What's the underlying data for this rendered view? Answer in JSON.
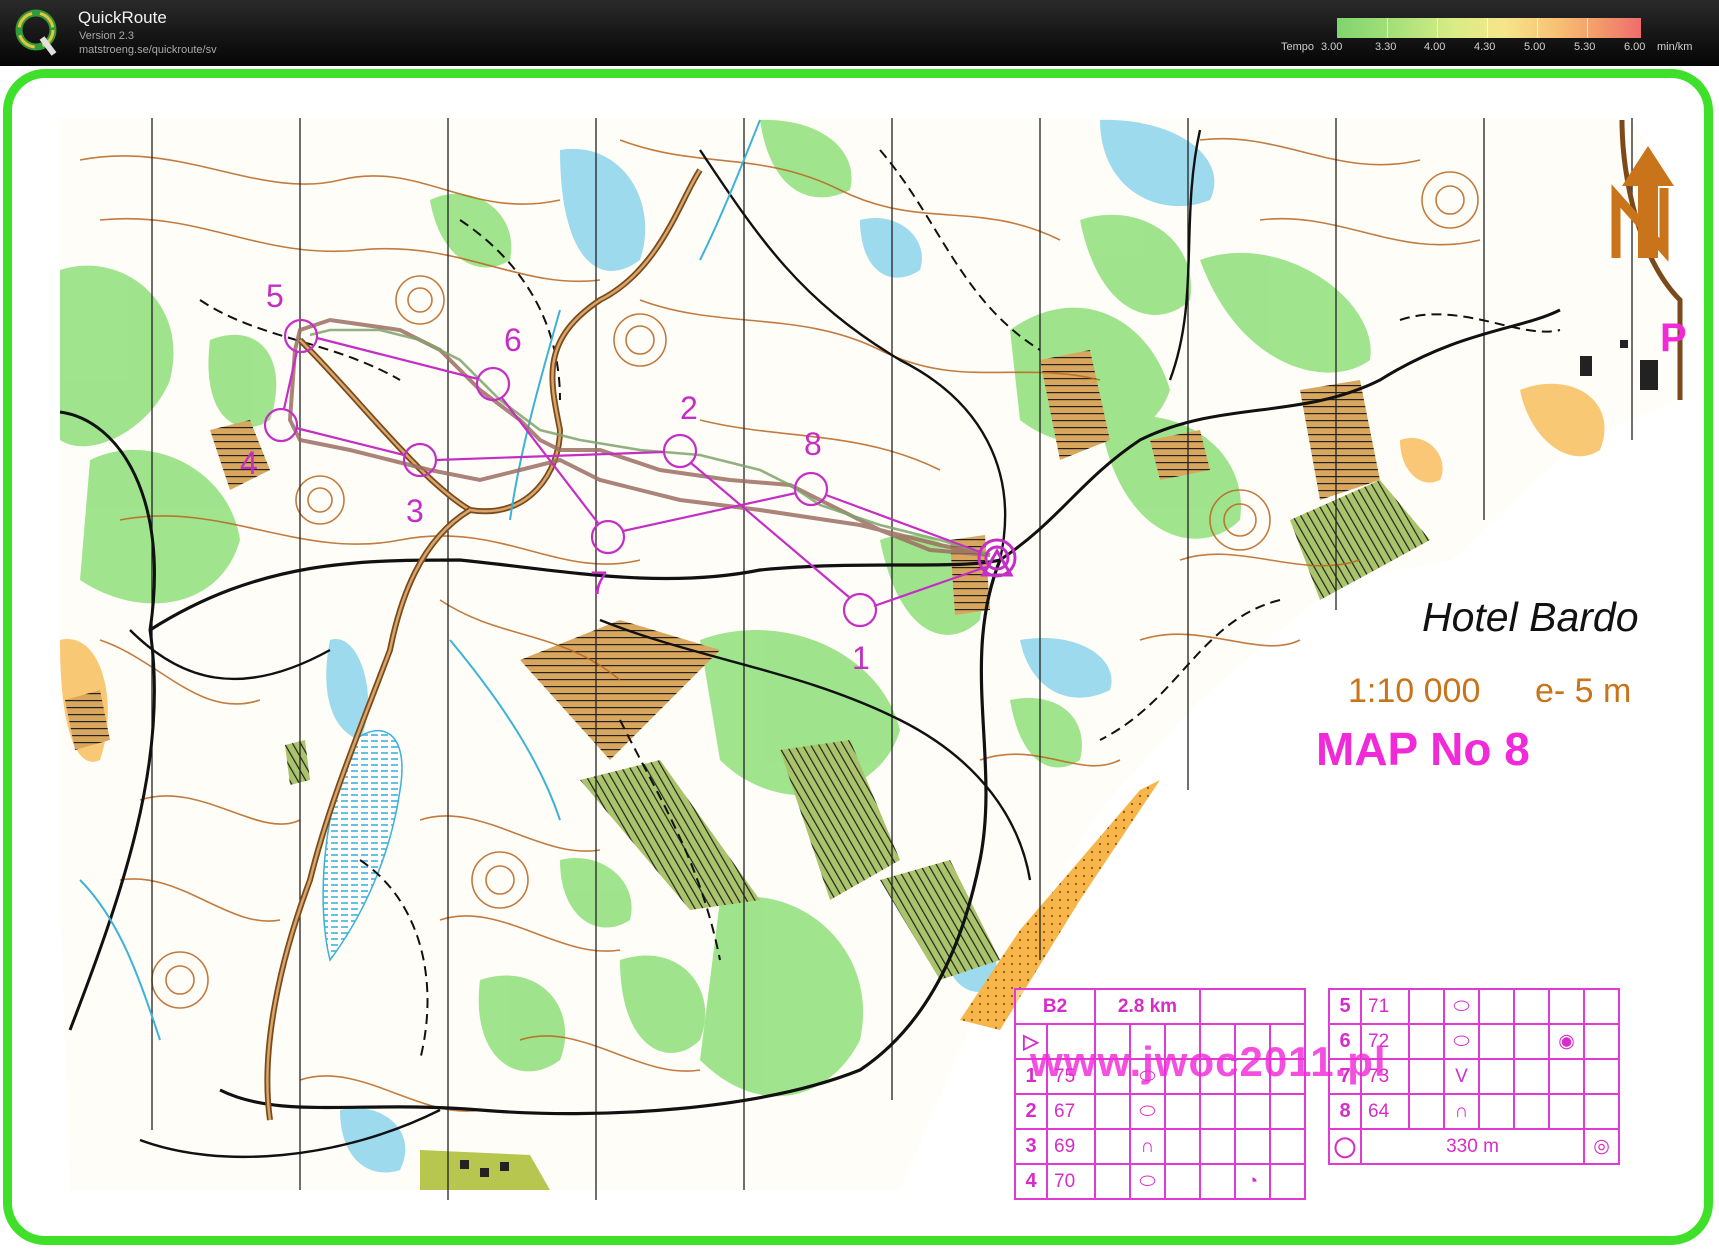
{
  "app": {
    "title": "QuickRoute",
    "version": "Version 2.3",
    "url": "matstroeng.se/quickroute/sv",
    "logo_letter": "Q"
  },
  "tempo_legend": {
    "prefix": "Tempo",
    "ticks": [
      "3.00",
      "3.30",
      "4.00",
      "4.30",
      "5.00",
      "5.30",
      "6.00"
    ],
    "unit": "min/km",
    "colors": [
      "#7fd46d",
      "#d7ec86",
      "#f6e58a",
      "#f7c276",
      "#ef6d6d"
    ]
  },
  "map": {
    "place_name": "Hotel Bardo",
    "scale": "1:10 000",
    "equidistance": "e- 5 m",
    "map_number": "MAP No 8",
    "parking_symbol": "P",
    "watermark": "www.jwoc2011.pl",
    "north_arrow_letter": "N",
    "colors": {
      "border": "#3ee02a",
      "course": "#c52ec5",
      "vegetation": "#8fe07a",
      "contours": "#b8651f",
      "water": "#3cb2d8",
      "route": "#9b6e62"
    }
  },
  "controls": [
    "1",
    "2",
    "3",
    "4",
    "5",
    "6",
    "7",
    "8"
  ],
  "description_sheet": {
    "class": "B2",
    "length": "2.8 km",
    "left_rows": [
      {
        "num": "1",
        "code": "75"
      },
      {
        "num": "2",
        "code": "67"
      },
      {
        "num": "3",
        "code": "69"
      },
      {
        "num": "4",
        "code": "70"
      }
    ],
    "right_rows": [
      {
        "num": "5",
        "code": "71"
      },
      {
        "num": "6",
        "code": "72"
      },
      {
        "num": "7",
        "code": "73"
      },
      {
        "num": "8",
        "code": "64"
      }
    ],
    "finish_distance": "330 m"
  }
}
